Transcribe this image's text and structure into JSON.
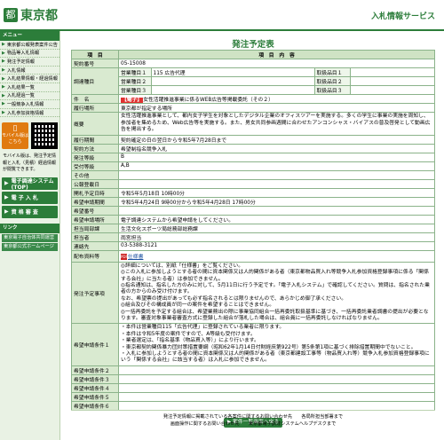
{
  "header": {
    "logo_mark": "都",
    "site_name": "東京都",
    "right_title": "入札情報サービス"
  },
  "sidebar": {
    "heading": "メニュー",
    "items": [
      {
        "label": "東京都公報発表案件公告"
      },
      {
        "label": "物品等入札情報"
      },
      {
        "label": "発注予定情報"
      },
      {
        "label": "入札情報"
      },
      {
        "label": "入札結果情報・経過情報"
      },
      {
        "label": "入札結果一覧"
      },
      {
        "label": "入札経過一覧"
      },
      {
        "label": "一般競争入札情報"
      },
      {
        "label": "入札参加資格情報"
      }
    ],
    "mobile_icon": "phone-icon",
    "mobile_label": "モバイル版はこちら",
    "mobile_note": "モバイル版は、発注予定情報と入札（見積）経過情報が閲覧できます。",
    "big_buttons": [
      {
        "label": "電子調達システム(TOP)"
      },
      {
        "label": "電 子 入 札"
      },
      {
        "label": "資 格 審 査"
      }
    ],
    "links_heading": "リンク",
    "links": [
      {
        "label": "東京電子自治体共同運営"
      },
      {
        "label": "東京都公式ホームページ"
      }
    ]
  },
  "main": {
    "title": "発注予定表",
    "col_item": "項　目",
    "col_content": "項　目　内　容",
    "rows": [
      {
        "label": "契約番号",
        "value": "05-15008"
      },
      {
        "label": "調達種目",
        "sub": [
          {
            "k": "営業種目１",
            "v": "115 広告代理",
            "k2": "取扱品目１",
            "v2": ""
          },
          {
            "k": "営業種目２",
            "v": "",
            "k2": "取扱品目２",
            "v2": ""
          },
          {
            "k": "営業種目３",
            "v": "",
            "k2": "取扱品目３",
            "v2": ""
          }
        ]
      },
      {
        "label": "件　名",
        "tag": "【電子】",
        "value": "女性活躍推進事業に係るWEB広告等掲載委託（その２）"
      },
      {
        "label": "履行場所",
        "value": "東京都が指定する場所"
      },
      {
        "label": "概要",
        "value": "女性活躍推進事業として、都内女子学生を対象としたデジタル企業のオフィスツアーを実施する。多くの学生に事業の実施を周知し、参加者を集めるため、Web広告等を実施する。また、男女共同参画週間に合わせたアンコンシャス・バイアスの普及啓発として動画広告を掲出する。"
      },
      {
        "label": "履行期間",
        "value": "契約確定の日の翌日から令和5年7月28日まで"
      },
      {
        "label": "契約方法",
        "value": "希望制指名競争入札"
      },
      {
        "label": "発注等級",
        "value": "B"
      },
      {
        "label": "受付等級",
        "value": "A,B"
      },
      {
        "label": "その他",
        "value": ""
      },
      {
        "label": "公報登載日",
        "value": ""
      },
      {
        "label": "開札予定日時",
        "value": "令和5年5月18日 10時00分"
      },
      {
        "label": "希望申請期間",
        "value": "令和5年4月24日 9時00分から令和5年4月28日 17時00分"
      },
      {
        "label": "希望番号",
        "value": ""
      },
      {
        "label": "希望申請場所",
        "value": "電子調達システムから希望申請をしてください。"
      },
      {
        "label": "担当局部課",
        "value": "生活文化スポーツ局総務部総務課"
      },
      {
        "label": "担当者",
        "value": "雨宮担当"
      },
      {
        "label": "連絡先",
        "value": "03-5388-3121"
      }
    ],
    "attach_label": "配布資料等",
    "attach_link": "仕様書",
    "apply_label": "発注予定事項",
    "apply_lines": [
      "◎詳細については、別紙「仕様書」をご覧ください。",
      "◎この入札に参加しようとする者の間に資本関係又は人的関係がある者（東京都物品買入れ等競争入札参加資格登録事項に係る「関係する会社」に当たる者）は参加できません。",
      "◎指名通知は、指名した方のみに対して、5月11日に行う予定です。「電子入札システム」で確認してください。質問は、指名された業者の方からのみ受け付けます。",
      "なお、希望票の提出があっても必ず指名されるとは限りませんので、あらかじめ御了承ください。",
      "◎組合及びその構成員が同一の案件を希望することはできません。",
      "◎一括再委託を予定する組合は、希望業務出の際に事業協同組合一括再委託取扱基準に基づき、一括再委託業者調書の提出が必要となります。審査対象事業者審査方式に登録した組合が落札した場合は、組合員に一括再委託しなければなりません。"
    ],
    "cond_label": "希望申請条件１",
    "cond_lines": [
      "・本件は営業種目115「広告代理」に登録されている業者に限ります。",
      "・本件は令和5年度の案件ですので、A等級も受付けます。",
      "・業者選定は、「指名基準（物品買入等）」により行います。",
      "・東京都契約関係暴力団対策措置要綱（昭和62年1月14日付財経庶第922号）第5条第1項に基づく排除措置期間中でないこと。",
      "・入札に参加しようとする者の間に資本関係又は人的関係がある者（東京都建設工事等（物品買入れ等）競争入札参加資格登録事項にいう「関係する会社」に該当する者）は入札に参加できません。"
    ],
    "cond_rows": [
      {
        "label": "希望申請条件２",
        "value": ""
      },
      {
        "label": "希望申請条件３",
        "value": ""
      },
      {
        "label": "希望申請条件４",
        "value": ""
      },
      {
        "label": "希望申請条件５",
        "value": ""
      },
      {
        "label": "希望申請条件６",
        "value": ""
      }
    ],
    "back_button": "▶ 案件一覧画面へ戻る"
  },
  "footer": {
    "line1": "発注予定情報に掲載されている各案件に関するお問い合わせ先　　各局所担当部署まで",
    "line2": "画面操作に関するお問い合わせ先　　東京都電子調達システムヘルプデスクまで"
  },
  "colors": {
    "brand": "#2c7d3a",
    "accent": "#e07a10",
    "tag": "#e03030"
  }
}
